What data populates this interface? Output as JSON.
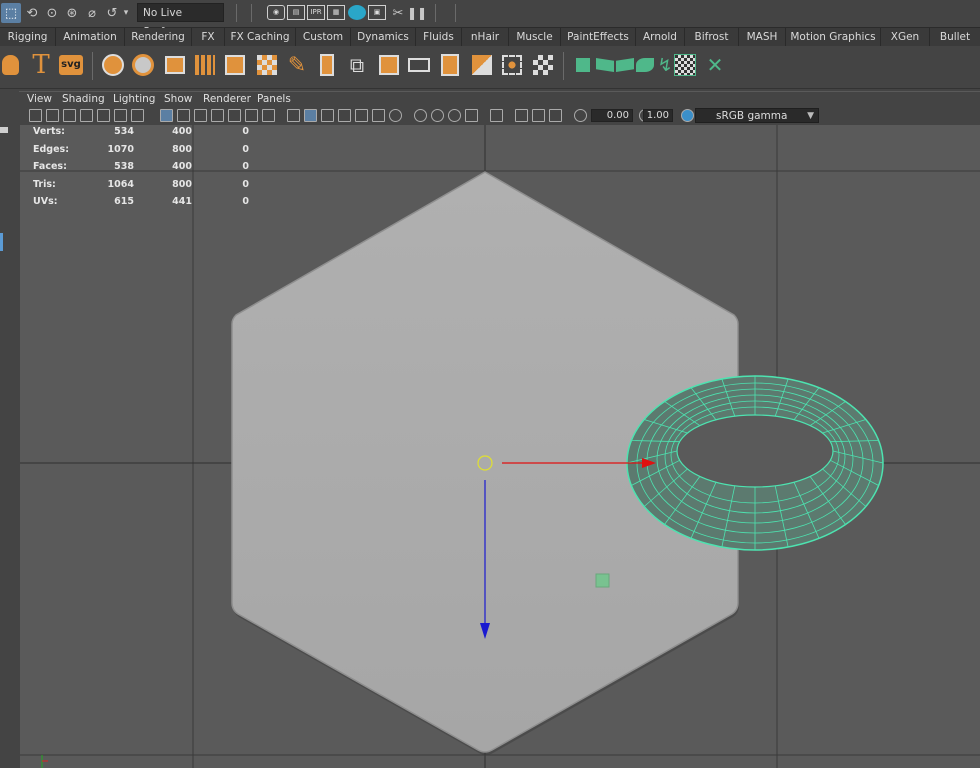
{
  "status_line": {
    "live_surface": "No Live Surface",
    "ipr_label": "IPR",
    "icons": [
      "select-by-hierarchy-icon",
      "select-by-object-icon",
      "select-by-component-icon",
      "snap-to-grid-icon",
      "snap-to-curve-icon",
      "snap-to-point-icon",
      "render-current-frame-icon",
      "ipr-render-icon",
      "render-settings-icon",
      "hypershade-icon",
      "render-view-icon",
      "pause-icon"
    ]
  },
  "shelf_tabs": [
    "Rigging",
    "Animation",
    "Rendering",
    "FX",
    "FX Caching",
    "Custom",
    "Dynamics",
    "Fluids",
    "nHair",
    "Muscle",
    "PaintEffects",
    "Arnold",
    "Bifrost",
    "MASH",
    "Motion Graphics",
    "XGen",
    "Bullet"
  ],
  "shelf": {
    "text_icon_label": "T",
    "svg_icon_label": "svg"
  },
  "panel_menu": [
    "View",
    "Shading",
    "Lighting",
    "Show",
    "Renderer",
    "Panels"
  ],
  "panel_toolbar": {
    "exposure": "0.00",
    "gamma": "1.00",
    "color_space": "sRGB gamma"
  },
  "hud": {
    "rows": [
      {
        "label": "Verts:",
        "a": "534",
        "b": "400",
        "c": "0"
      },
      {
        "label": "Edges:",
        "a": "1070",
        "b": "800",
        "c": "0"
      },
      {
        "label": "Faces:",
        "a": "538",
        "b": "400",
        "c": "0"
      },
      {
        "label": "Tris:",
        "a": "1064",
        "b": "800",
        "c": "0"
      },
      {
        "label": "UVs:",
        "a": "615",
        "b": "441",
        "c": "0"
      }
    ]
  },
  "colors": {
    "viewport_bg": "#5a5a5a",
    "svg_mesh": "#a9a9a9",
    "torus_wire": "#4de3b0",
    "manip_x": "#e01010",
    "manip_y": "#1a1ad0",
    "pivot": "#e0e030"
  }
}
